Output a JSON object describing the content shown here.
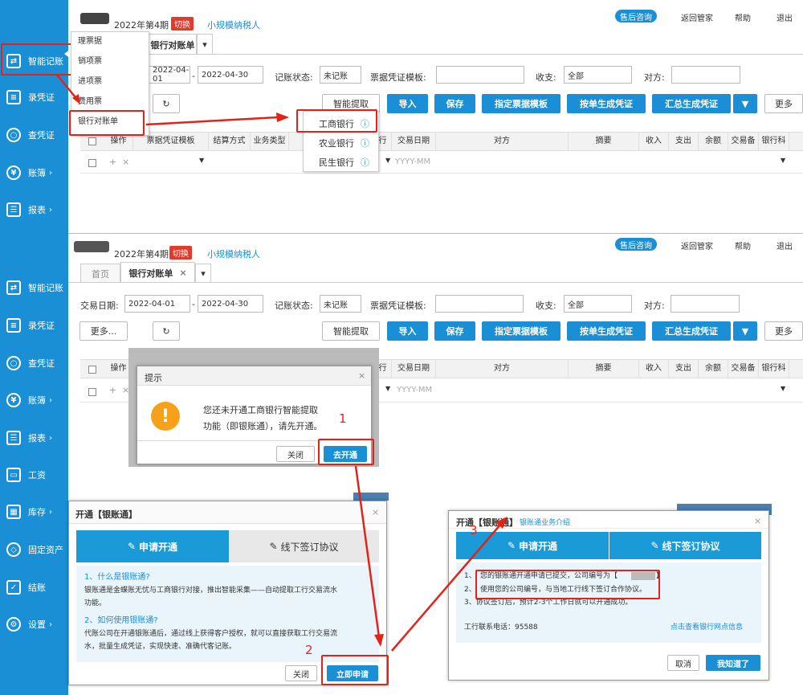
{
  "header": {
    "period": "2022年第4期",
    "switch_label": "切换",
    "taxpayer": "小规模纳税人",
    "service": "售后咨询",
    "back": "返回管家",
    "help": "帮助",
    "logout": "退出"
  },
  "sidebar": {
    "items": [
      {
        "label": "智能记账",
        "icon": "smart-ledger-icon"
      },
      {
        "label": "录凭证",
        "icon": "voucher-entry-icon"
      },
      {
        "label": "查凭证",
        "icon": "search-icon"
      },
      {
        "label": "账簿",
        "icon": "yen-icon"
      },
      {
        "label": "报表",
        "icon": "report-icon"
      },
      {
        "label": "工资",
        "icon": "salary-icon"
      },
      {
        "label": "库存",
        "icon": "inventory-icon"
      },
      {
        "label": "固定资产",
        "icon": "asset-icon"
      },
      {
        "label": "结账",
        "icon": "checkout-icon"
      },
      {
        "label": "设置",
        "icon": "gear-icon"
      }
    ]
  },
  "submenu": [
    "理票据",
    "销项票",
    "进项票",
    "费用票",
    "银行对账单"
  ],
  "tabs": {
    "home": "首页",
    "bank": "银行对账单"
  },
  "filters": {
    "date_label": "交易日期:",
    "date_from": "2022-04-01",
    "date_to": "2022-04-30",
    "status_label": "记账状态:",
    "status_value": "未记账",
    "template_label": "票据凭证模板:",
    "income_label": "收支:",
    "income_value": "全部",
    "party_label": "对方:"
  },
  "toolbar": {
    "more": "更多...",
    "smart_extract": "智能提取",
    "import": "导入",
    "save": "保存",
    "assign_template": "指定票据模板",
    "gen_by_bill": "按单生成凭证",
    "gen_summary": "汇总生成凭证",
    "more2": "更多"
  },
  "bank_options": [
    "工商银行",
    "农业银行",
    "民生银行"
  ],
  "table": {
    "headers": [
      "操作",
      "票据凭证模板",
      "结算方式",
      "业务类型",
      "行",
      "交易日期",
      "对方",
      "摘要",
      "收入",
      "支出",
      "余额",
      "交易备",
      "银行科"
    ],
    "date_placeholder": "YYYY-MM"
  },
  "prompt": {
    "title": "提示",
    "message_1": "您还未开通工商银行智能提取",
    "message_2": "功能（即银账通），请先开通。",
    "close": "关闭",
    "open": "去开通"
  },
  "modal2": {
    "title": "开通【银账通】",
    "step1": "申请开通",
    "step2": "线下签订协议",
    "q1": "1、什么是银账通?",
    "a1_1": "银账通是金蝶账无忧与工商银行对接，推出智能采集——自动提取工行交易流水",
    "a1_2": "功能。",
    "q2": "2、如何使用银账通?",
    "a2_1": "代账公司在开通银账通后，通过线上获得客户授权，就可以直接获取工行交易流",
    "a2_2": "水，批量生成凭证，实现快速、准确代客记账。",
    "close": "关闭",
    "apply": "立即申请"
  },
  "modal3": {
    "title": "开通【银账通】",
    "intro_link": "银账通业务介绍",
    "step1": "申请开通",
    "step2": "线下签订协议",
    "line1_pre": "1、",
    "line1": "您的银账通开通申请已提交，公司编号为【",
    "line1_post": "】",
    "line2_pre": "2、",
    "line2": "使用您的公司编号，与当地工行线下签订合作协议。",
    "line3": "3、协议签订后，预计2-3个工作日就可以开通成功。",
    "phone": "工行联系电话：95588",
    "branch_link": "点击查看银行网点信息",
    "cancel": "取消",
    "ok": "我知道了"
  },
  "annotations": {
    "n1": "1",
    "n2": "2",
    "n3": "3"
  },
  "colors": {
    "accent": "#1a8fd6",
    "highlight": "#e2231a"
  }
}
